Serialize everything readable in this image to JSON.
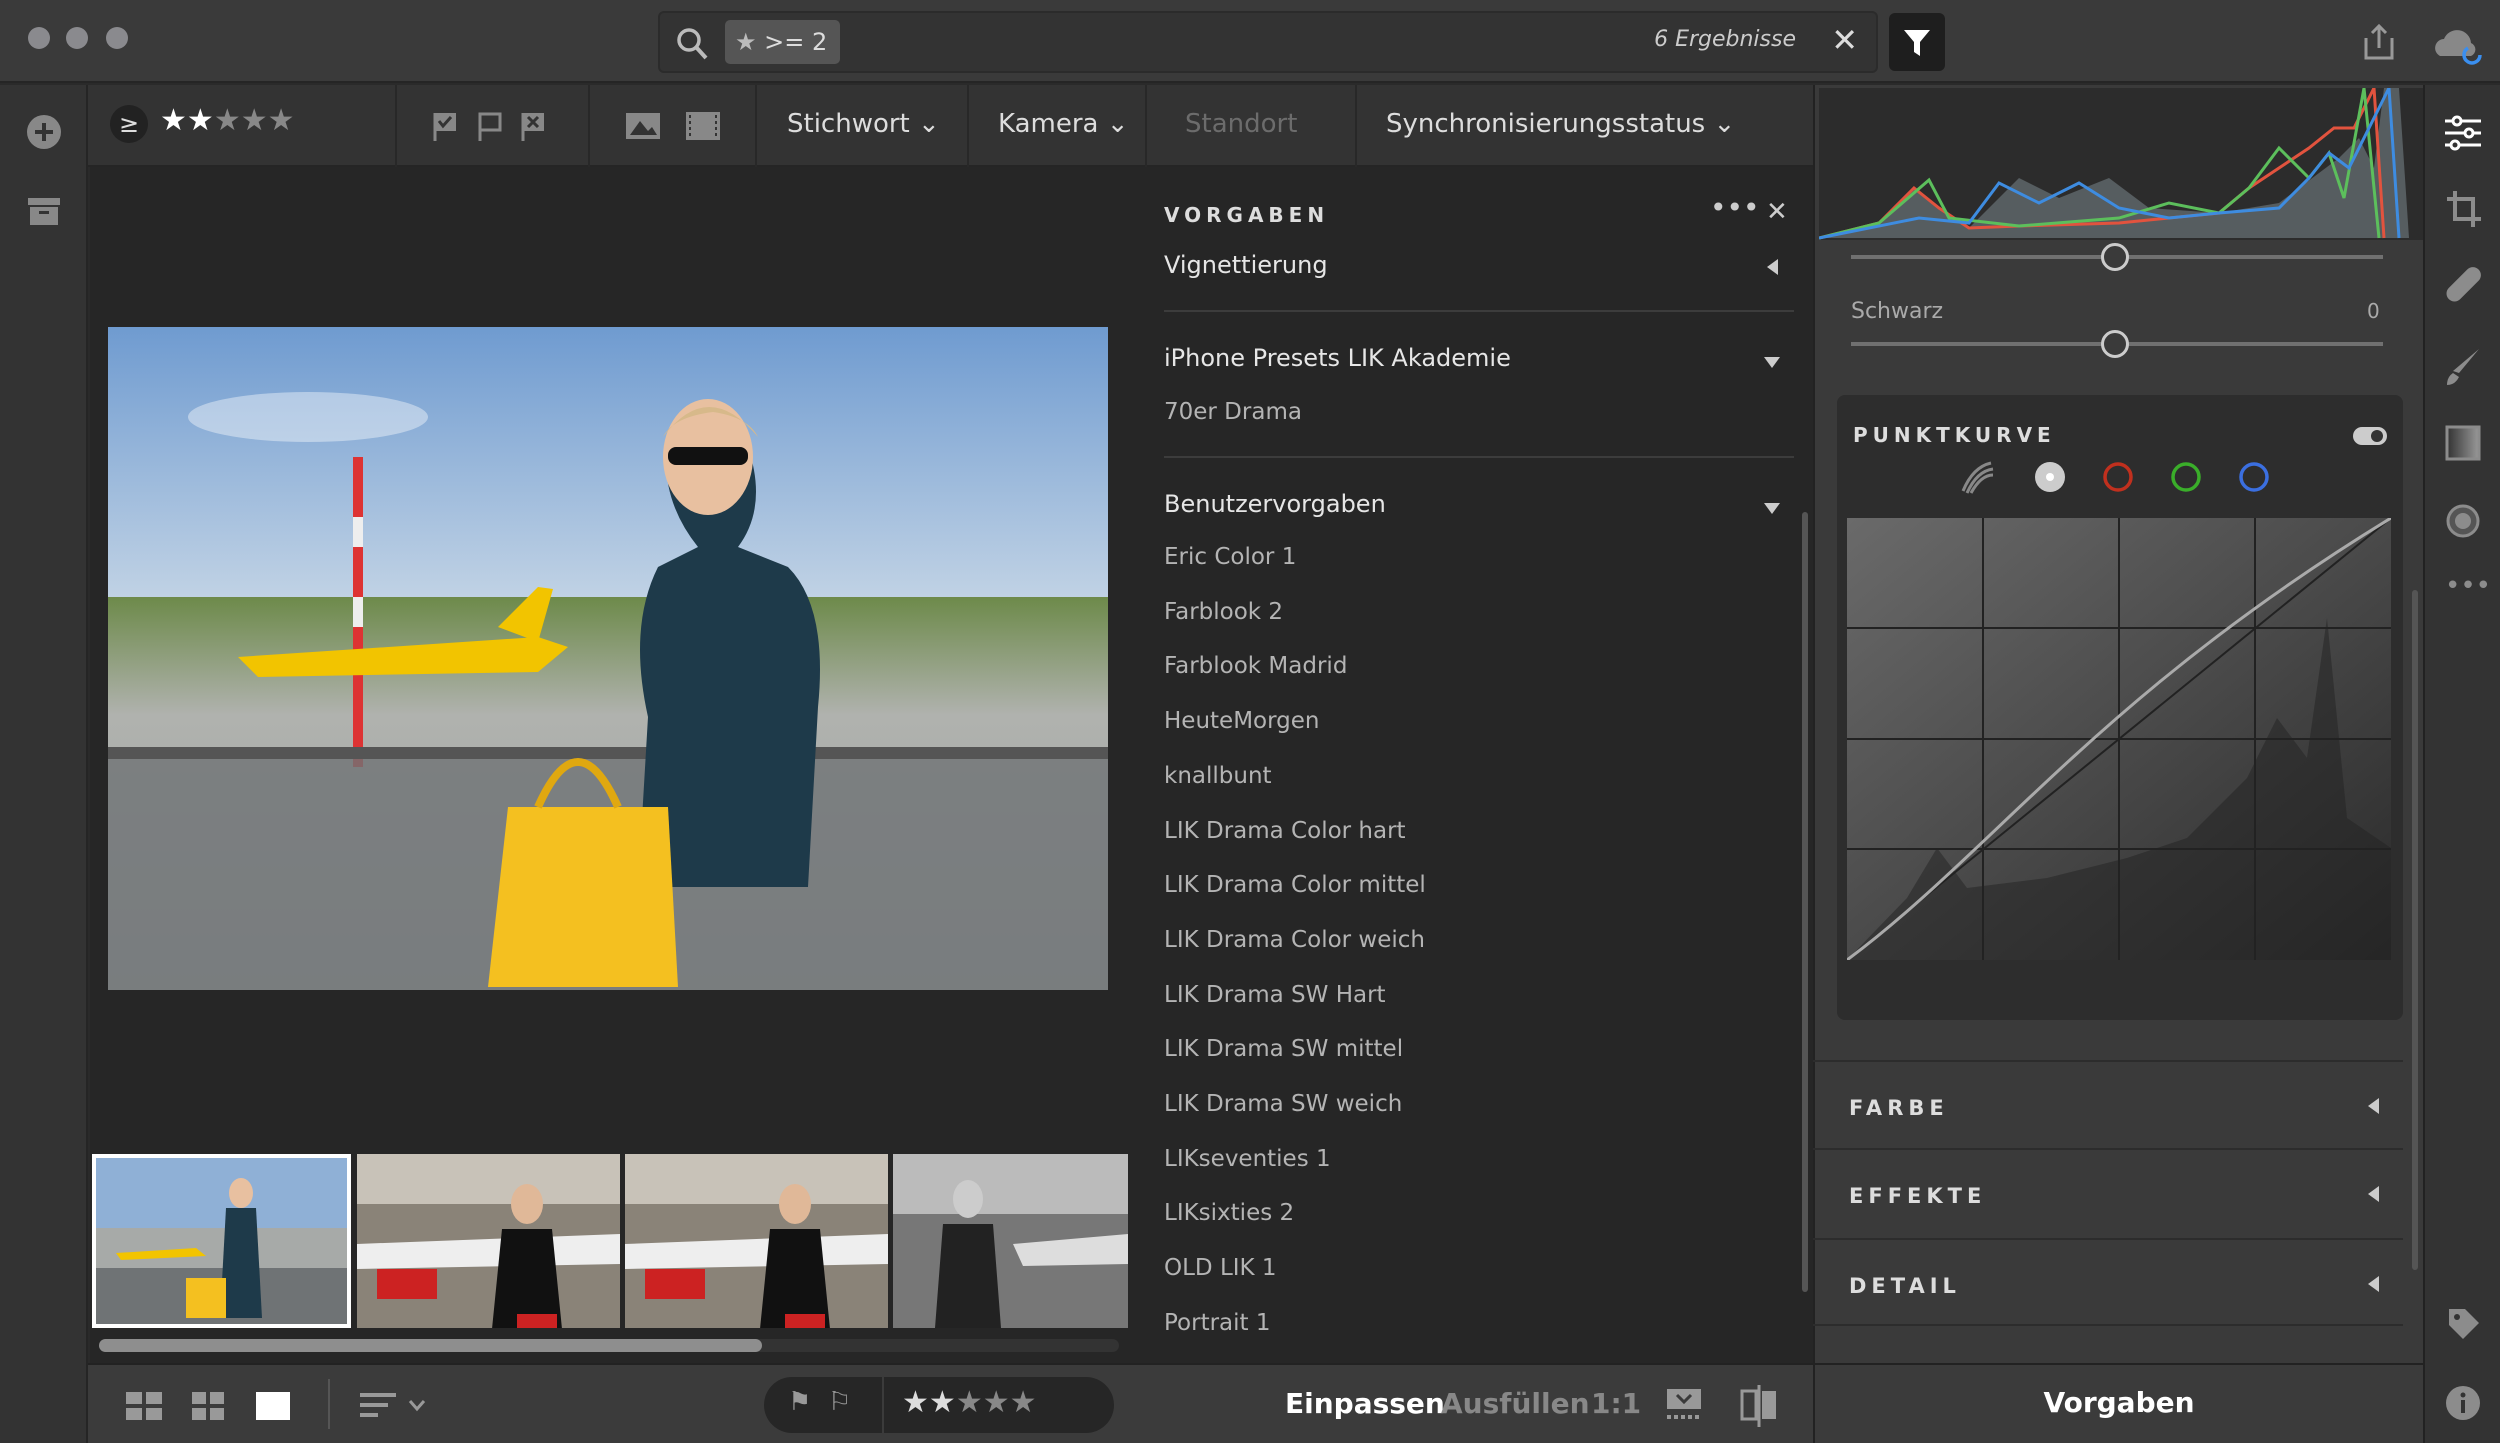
{
  "search": {
    "filter_chip": ">= 2",
    "results": "6 Ergebnisse"
  },
  "toolbar": {
    "rating_operator": "≥",
    "rating_value": 2,
    "rating_max": 5,
    "menus": [
      {
        "label": "Stichwort",
        "enabled": true
      },
      {
        "label": "Kamera",
        "enabled": true
      },
      {
        "label": "Standort",
        "enabled": false
      },
      {
        "label": "Synchronisierungsstatus",
        "enabled": true
      }
    ]
  },
  "presets": {
    "title": "VORGABEN",
    "groups": [
      {
        "label": "Vignettierung",
        "expanded": false,
        "items": []
      },
      {
        "label": "iPhone Presets LIK Akademie",
        "expanded": true,
        "items": [
          "70er Drama"
        ]
      },
      {
        "label": "Benutzervorgaben",
        "expanded": true,
        "items": [
          "Eric Color 1",
          "Farblook 2",
          "Farblook Madrid",
          "HeuteMorgen",
          "knallbunt",
          "LIK Drama Color hart",
          "LIK Drama Color mittel",
          "LIK Drama Color weich",
          "LIK Drama SW Hart",
          "LIK Drama SW mittel",
          "LIK Drama SW weich",
          "LIKseventies 1",
          "LIKsixties 2",
          "OLD LIK 1",
          "Portrait 1"
        ]
      }
    ]
  },
  "bottombar": {
    "fit": "Einpassen",
    "fill": "Ausfüllen",
    "one_to_one": "1:1",
    "rating_max": 5
  },
  "right_panel": {
    "black_label": "Schwarz",
    "black_value": "0",
    "curve_title": "PUNKTKURVE",
    "sections": [
      "FARBE",
      "EFFEKTE",
      "DETAIL"
    ],
    "bottom_label": "Vorgaben",
    "channel_colors": {
      "rgb": "#cccccc",
      "red": "#c0301e",
      "green": "#3aae2a",
      "blue": "#3b6fe0"
    }
  }
}
